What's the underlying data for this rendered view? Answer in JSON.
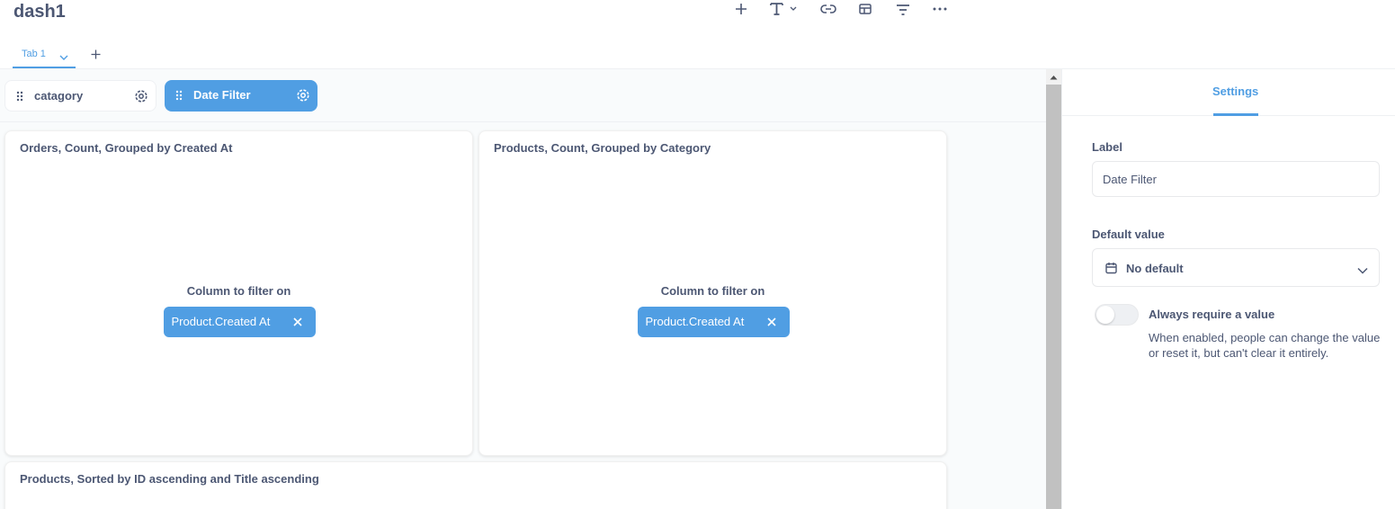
{
  "header": {
    "title": "dash1",
    "toolbar": [
      {
        "name": "add-icon"
      },
      {
        "name": "text-icon"
      },
      {
        "name": "link-icon"
      },
      {
        "name": "section-icon"
      },
      {
        "name": "filter-icon"
      },
      {
        "name": "more-icon"
      }
    ],
    "tabs": [
      {
        "label": "Tab 1"
      }
    ]
  },
  "filters": [
    {
      "label": "catagory",
      "active": false
    },
    {
      "label": "Date Filter",
      "active": true
    }
  ],
  "cards": [
    {
      "title": "Orders, Count, Grouped by Created At",
      "column_label": "Column to filter on",
      "column_value": "Product.Created At"
    },
    {
      "title": "Products, Count, Grouped by Category",
      "column_label": "Column to filter on",
      "column_value": "Product.Created At"
    },
    {
      "title": "Products, Sorted by ID ascending and Title ascending"
    }
  ],
  "sidebar": {
    "tab": "Settings",
    "label_title": "Label",
    "label_value": "Date Filter",
    "default_title": "Default value",
    "default_value": "No default",
    "toggle_label": "Always require a value",
    "toggle_on": false,
    "toggle_desc": "When enabled, people can change the value or reset it, but can't clear it entirely."
  },
  "colors": {
    "accent": "#509ee3",
    "text": "#4c5773",
    "canvas_bg": "#f9fbfc"
  }
}
